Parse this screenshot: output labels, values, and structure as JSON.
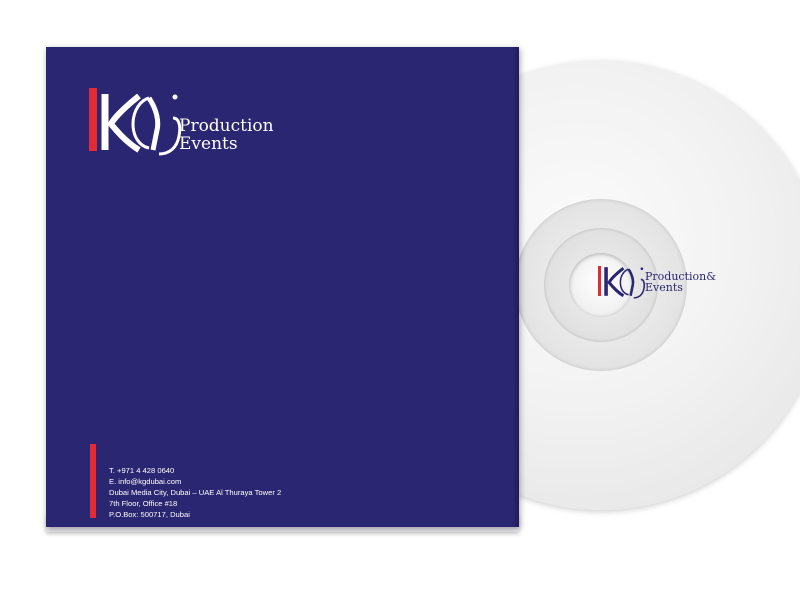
{
  "brand": {
    "logo_letters": "KG",
    "line1": "Production",
    "line2": "Events",
    "disc_line1": "Production&",
    "disc_line2": "Events"
  },
  "contact": {
    "phone": "T.  +971 4 428 0640",
    "email": "E.  info@kgdubai.com",
    "address1": "Dubai Media City, Dubai – UAE Al Thuraya Tower 2",
    "address2": "7th Floor, Office #18",
    "pobox": "P.O.Box: 500717, Dubai"
  },
  "colors": {
    "sleeve": "#2a2671",
    "accent": "#e32b35",
    "disc": "#f2f2f2",
    "text_on_sleeve": "#ffffff",
    "text_on_disc": "#2b2672"
  },
  "icons": {
    "logo_mark": "kg-monogram-icon"
  }
}
